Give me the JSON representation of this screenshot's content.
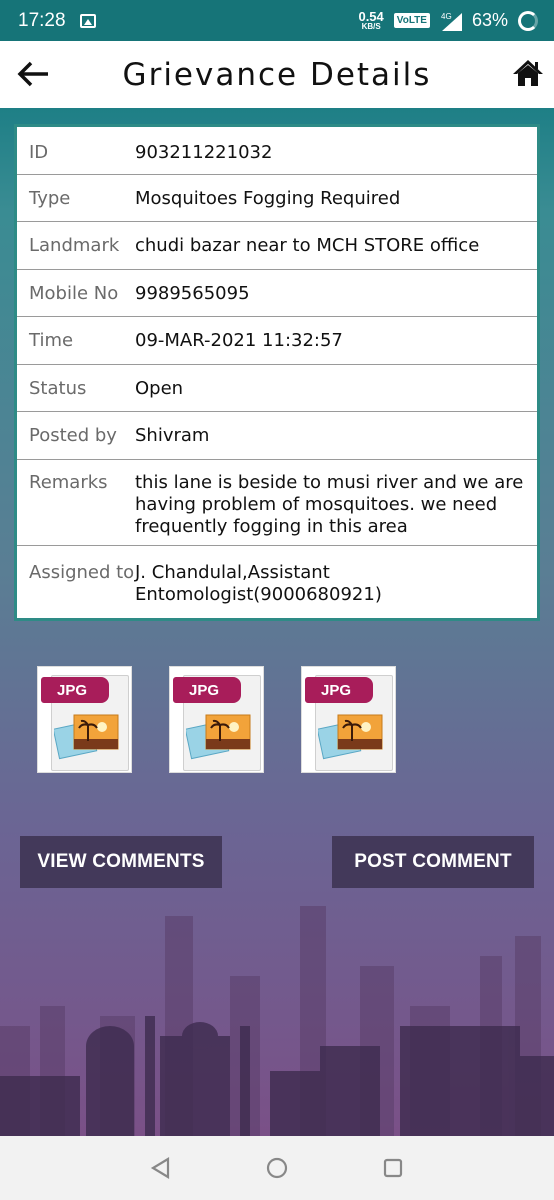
{
  "status_bar": {
    "time": "17:28",
    "net_speed_value": "0.54",
    "net_speed_unit": "KB/S",
    "volte": "VoLTE",
    "network": "4G",
    "battery": "63%"
  },
  "header": {
    "title": "Grievance Details"
  },
  "details": [
    {
      "label": "ID",
      "value": "903211221032"
    },
    {
      "label": "Type",
      "value": "Mosquitoes Fogging Required"
    },
    {
      "label": "Landmark",
      "value": "chudi bazar near to MCH STORE office"
    },
    {
      "label": "Mobile No",
      "value": "9989565095"
    },
    {
      "label": "Time",
      "value": "09-MAR-2021 11:32:57"
    },
    {
      "label": "Status",
      "value": "Open"
    },
    {
      "label": "Posted by",
      "value": "Shivram"
    },
    {
      "label": "Remarks",
      "value": "this lane is beside to musi river and we are having problem of mosquitoes. we need frequently fogging in this area"
    },
    {
      "label": "Assigned to",
      "value": "J. Chandulal,Assistant Entomologist(9000680921)"
    }
  ],
  "attachments": [
    {
      "label": "JPG"
    },
    {
      "label": "JPG"
    },
    {
      "label": "JPG"
    }
  ],
  "buttons": {
    "view_comments": "VIEW COMMENTS",
    "post_comment": "POST COMMENT"
  },
  "colors": {
    "status_bar": "#167478",
    "button": "#43395a",
    "card_border": "#2e8b86",
    "jpg_tag": "#a81d5a"
  }
}
